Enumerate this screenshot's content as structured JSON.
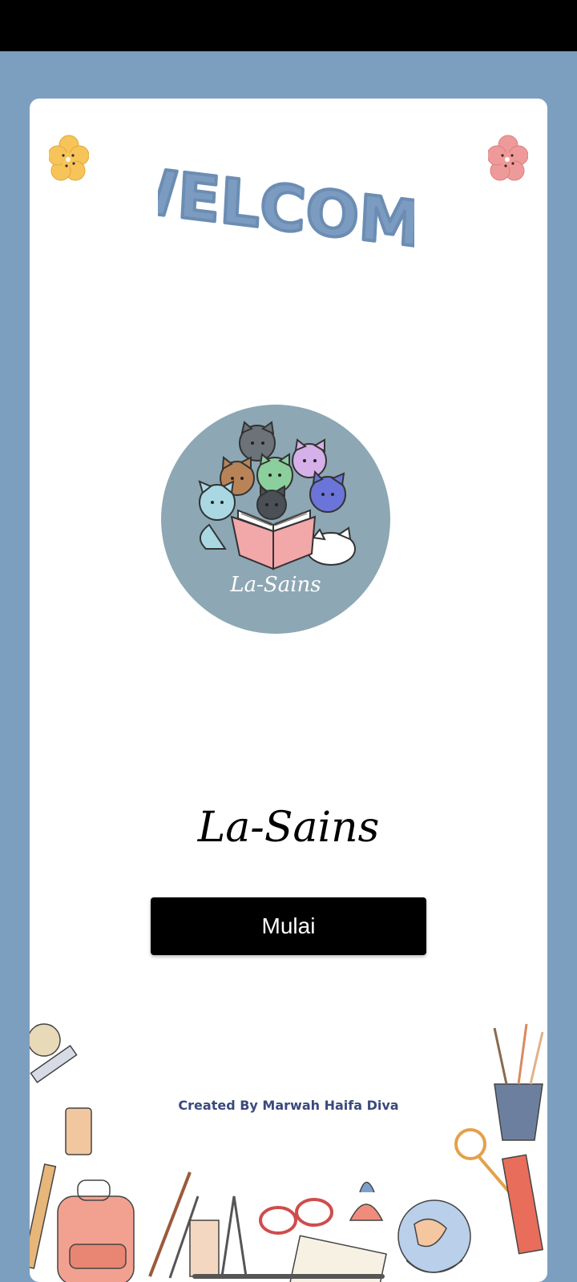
{
  "header": {
    "welcome_text": "WELCOME"
  },
  "logo": {
    "caption": "La-Sains"
  },
  "app": {
    "title": "La-Sains"
  },
  "actions": {
    "start_label": "Mulai"
  },
  "footer": {
    "credit": "Created By Marwah Haifa Diva"
  },
  "colors": {
    "background": "#7c9fc0",
    "welcome": "#7b9cc0",
    "logo_circle": "#8da7b4",
    "button": "#000000",
    "credit_text": "#3a4a7c"
  },
  "icons": {
    "flower_left": "yellow-flower-icon",
    "flower_right": "pink-flower-icon"
  }
}
